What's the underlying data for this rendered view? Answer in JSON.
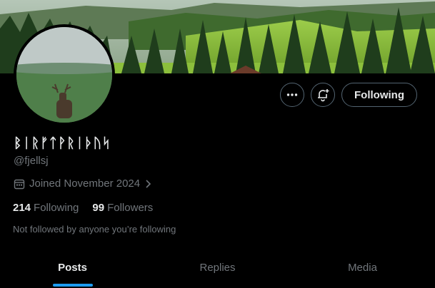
{
  "profile": {
    "display_name": "ᛒᛁᚱᚠᛏᚹᚱᛁᚦᚢᛋ",
    "handle": "@fjellsj",
    "joined": "Joined November 2024",
    "following_count": "214",
    "following_label": "Following",
    "followers_count": "99",
    "followers_label": "Followers",
    "note": "Not followed by anyone you’re following"
  },
  "actions": {
    "more_icon": "more-icon",
    "subscribe_icon": "bell-plus-icon",
    "follow_label": "Following"
  },
  "tabs": [
    {
      "label": "Posts",
      "active": true
    },
    {
      "label": "Replies",
      "active": false
    },
    {
      "label": "Media",
      "active": false
    }
  ],
  "colors": {
    "accent": "#1d9bf0",
    "background": "#000000",
    "secondary_text": "#71767b",
    "border": "#536471"
  }
}
